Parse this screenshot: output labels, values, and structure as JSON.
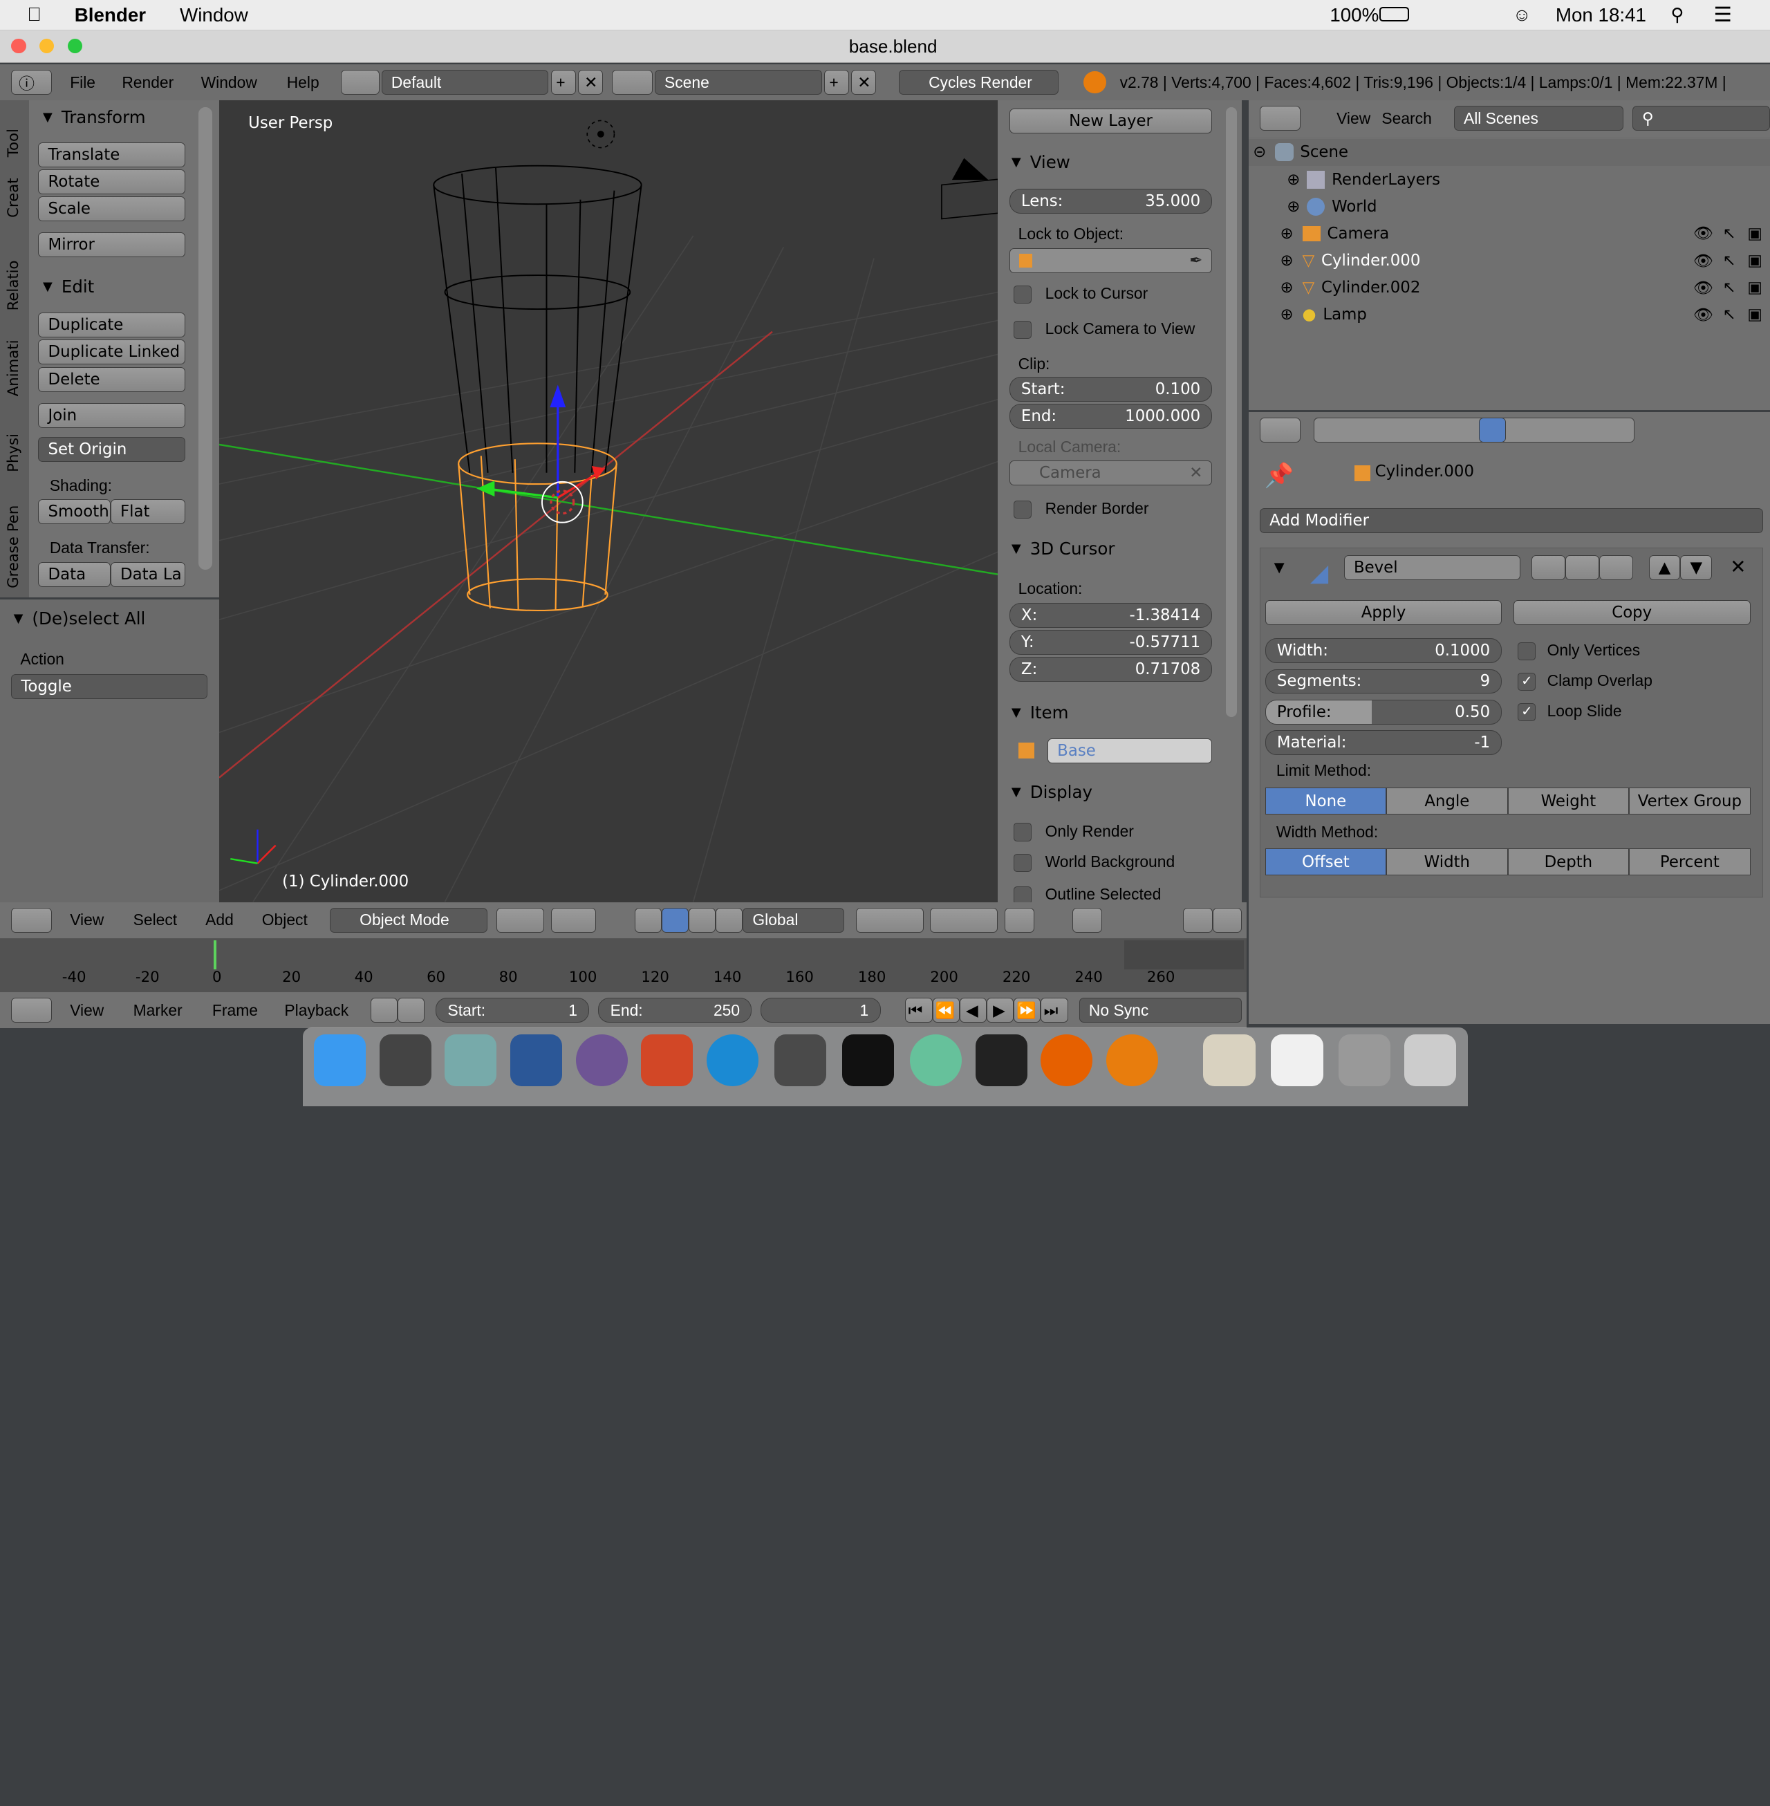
{
  "menubar": {
    "app": "Blender",
    "window": "Window",
    "battery": "100%",
    "clock": "Mon 18:41"
  },
  "titlebar": {
    "title": "base.blend"
  },
  "info_header": {
    "menus": [
      "File",
      "Render",
      "Window",
      "Help"
    ],
    "layout": "Default",
    "scene": "Scene",
    "engine": "Cycles Render",
    "stats": "v2.78 | Verts:4,700 | Faces:4,602 | Tris:9,196 | Objects:1/4 | Lamps:0/1 | Mem:22.37M |"
  },
  "tool_tabs": [
    "Tool",
    "Creat",
    "Relatio",
    "Animati",
    "Physi",
    "Grease Pen"
  ],
  "toolshelf": {
    "transform_title": "Transform",
    "translate": "Translate",
    "rotate": "Rotate",
    "scale": "Scale",
    "mirror": "Mirror",
    "edit_title": "Edit",
    "duplicate": "Duplicate",
    "duplicate_linked": "Duplicate Linked",
    "delete": "Delete",
    "join": "Join",
    "set_origin": "Set Origin",
    "shading_label": "Shading:",
    "smooth": "Smooth",
    "flat": "Flat",
    "data_transfer_label": "Data Transfer:",
    "data": "Data",
    "data_la": "Data La",
    "deselect_title": "(De)select All",
    "action_label": "Action",
    "action_value": "Toggle"
  },
  "viewport": {
    "persp_label": "User Persp",
    "object_label": "(1) Cylinder.000"
  },
  "nprops": {
    "new_layer": "New Layer",
    "view_title": "View",
    "lens_label": "Lens:",
    "lens_value": "35.000",
    "lock_obj_label": "Lock to Object:",
    "lock_cursor": "Lock to Cursor",
    "lock_camera": "Lock Camera to View",
    "clip_label": "Clip:",
    "start_label": "Start:",
    "start_value": "0.100",
    "end_label": "End:",
    "end_value": "1000.000",
    "local_camera_label": "Local Camera:",
    "camera_value": "Camera",
    "render_border": "Render Border",
    "cursor_title": "3D Cursor",
    "location_label": "Location:",
    "x_label": "X:",
    "x_value": "-1.38414",
    "y_label": "Y:",
    "y_value": "-0.57711",
    "z_label": "Z:",
    "z_value": "0.71708",
    "item_title": "Item",
    "item_name": "Base",
    "display_title": "Display",
    "only_render": "Only Render",
    "world_background": "World Background",
    "outline_selected": "Outline Selected"
  },
  "view3d_header": {
    "menus": [
      "View",
      "Select",
      "Add",
      "Object"
    ],
    "mode": "Object Mode",
    "orientation": "Global"
  },
  "timeline": {
    "ticks": [
      "-40",
      "-20",
      "0",
      "20",
      "40",
      "60",
      "80",
      "100",
      "120",
      "140",
      "160",
      "180",
      "200",
      "220",
      "240",
      "260"
    ],
    "menus": [
      "View",
      "Marker",
      "Frame",
      "Playback"
    ],
    "start_label": "Start:",
    "start_value": "1",
    "end_label": "End:",
    "end_value": "250",
    "current": "1",
    "sync": "No Sync"
  },
  "outliner": {
    "menus": [
      "View",
      "Search"
    ],
    "filter": "All Scenes",
    "items": [
      {
        "label": "Scene",
        "icon": "scene-icon"
      },
      {
        "label": "RenderLayers",
        "icon": "renderlayers-icon"
      },
      {
        "label": "World",
        "icon": "world-icon"
      },
      {
        "label": "Camera",
        "icon": "camera-icon"
      },
      {
        "label": "Cylinder.000",
        "icon": "mesh-icon"
      },
      {
        "label": "Cylinder.002",
        "icon": "mesh-icon"
      },
      {
        "label": "Lamp",
        "icon": "lamp-icon"
      }
    ]
  },
  "properties": {
    "object_name": "Cylinder.000",
    "add_modifier": "Add Modifier",
    "modifier_name": "Bevel",
    "apply": "Apply",
    "copy": "Copy",
    "width_label": "Width:",
    "width_value": "0.1000",
    "segments_label": "Segments:",
    "segments_value": "9",
    "profile_label": "Profile:",
    "profile_value": "0.50",
    "profile_fraction": 0.5,
    "material_label": "Material:",
    "material_value": "-1",
    "only_vertices": "Only Vertices",
    "clamp_overlap": "Clamp Overlap",
    "loop_slide": "Loop Slide",
    "limit_method_label": "Limit Method:",
    "limit_methods": [
      "None",
      "Angle",
      "Weight",
      "Vertex Group"
    ],
    "width_method_label": "Width Method:",
    "width_methods": [
      "Offset",
      "Width",
      "Depth",
      "Percent"
    ]
  },
  "colors": {
    "accent": "#5680c2",
    "selection": "#ffa030",
    "viewport_bg": "#393939",
    "panel": "#727272"
  }
}
